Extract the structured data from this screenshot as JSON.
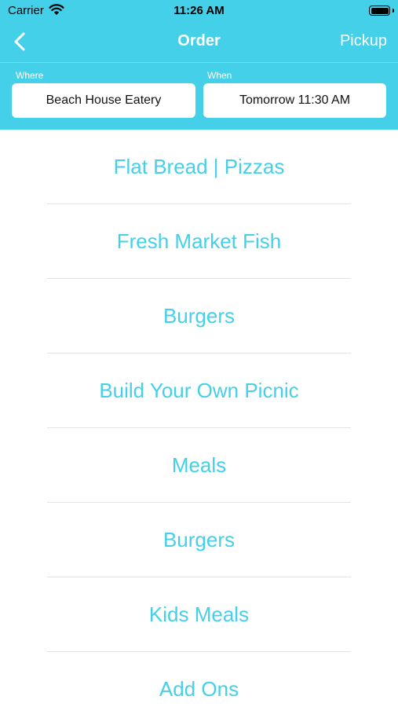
{
  "status_bar": {
    "carrier": "Carrier",
    "time": "11:26 AM"
  },
  "nav": {
    "back_icon": "chevron-left-icon",
    "title": "Order",
    "right_label": "Pickup"
  },
  "where": {
    "label": "Where",
    "value": "Beach House Eatery"
  },
  "when": {
    "label": "When",
    "value": "Tomorrow 11:30 AM"
  },
  "menu": {
    "items": [
      "Flat Bread | Pizzas",
      "Fresh Market Fish",
      "Burgers",
      "Build Your Own Picnic",
      "Meals",
      "Burgers",
      "Kids Meals",
      "Add Ons"
    ]
  },
  "colors": {
    "accent": "#44d0e8",
    "separator": "#e4e4e4"
  }
}
